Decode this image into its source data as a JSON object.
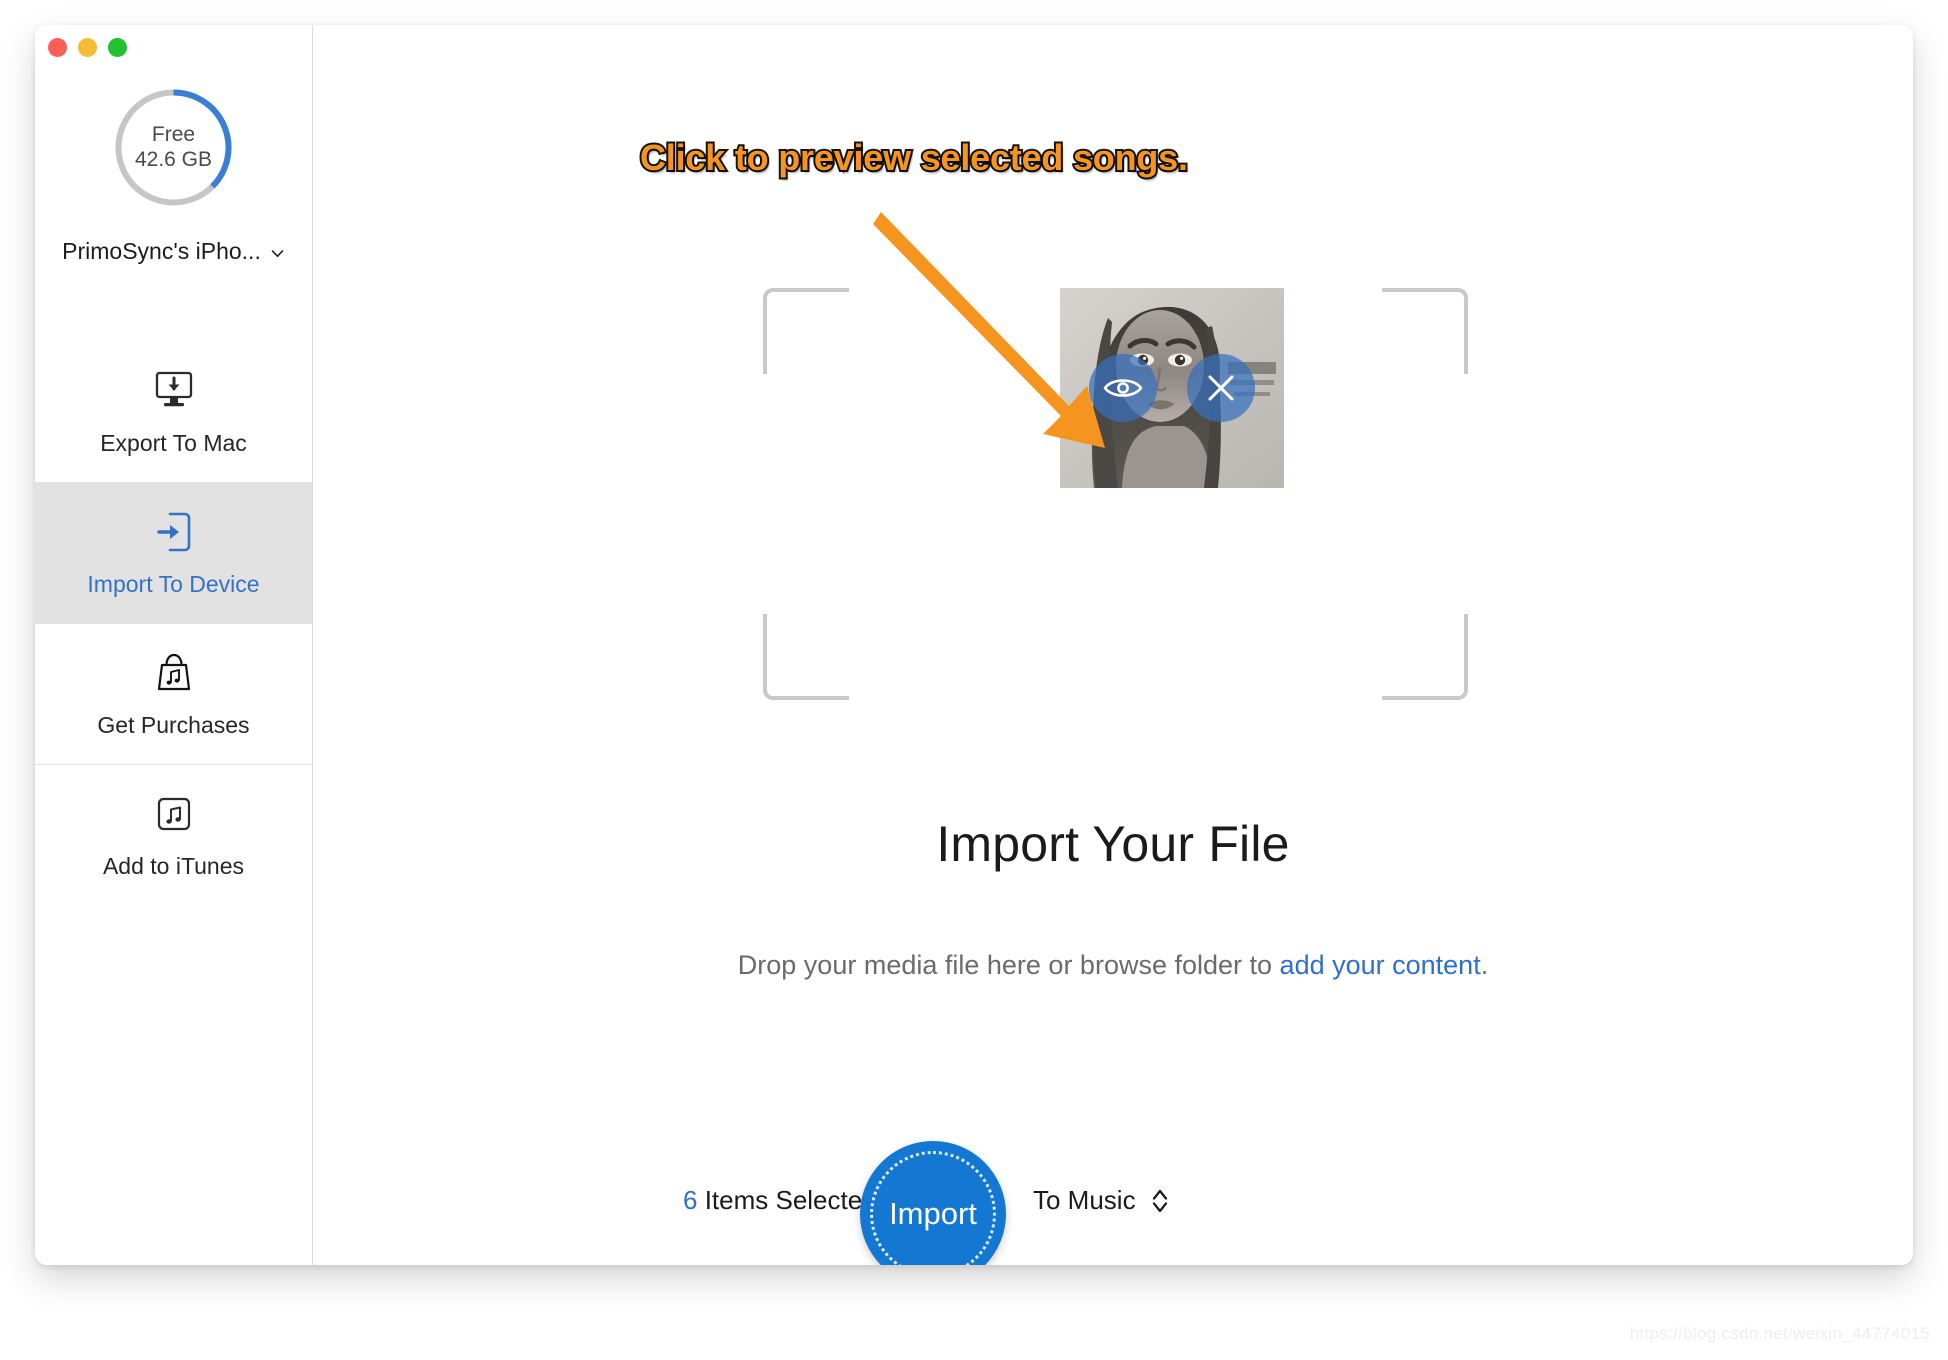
{
  "window": {
    "traffic_lights": {
      "close": "close-button",
      "minimize": "minimize-button",
      "maximize": "maximize-button"
    }
  },
  "sidebar": {
    "storage": {
      "free_label": "Free",
      "free_value": "42.6 GB",
      "used_percent": 30,
      "arc_color": "#3a7fd5",
      "track_color": "#c6c6c6"
    },
    "device": {
      "name": "PrimoSync's iPho...",
      "chevron": "chevron-down-icon"
    },
    "items": [
      {
        "label": "Export To Mac",
        "icon": "monitor-download-icon",
        "selected": false
      },
      {
        "label": "Import To Device",
        "icon": "import-arrow-icon",
        "selected": true
      },
      {
        "label": "Get Purchases",
        "icon": "shopping-bag-music-icon",
        "selected": false
      },
      {
        "label": "Add to iTunes",
        "icon": "music-note-square-icon",
        "selected": false
      }
    ]
  },
  "annotation": {
    "text": "Click to preview selected songs.",
    "text_color": "#f5941f",
    "outline_color": "#141414",
    "arrow_color": "#f5941f"
  },
  "main": {
    "dropzone": {
      "bracket_color": "#c9c9c9"
    },
    "thumbnail": {
      "alt": "album-artwork",
      "preview_button": "eye-icon",
      "remove_button": "close-x-icon",
      "button_color": "#3870bd"
    },
    "title": "Import Your File",
    "subtitle_prefix": "Drop your media file here or browse folder to ",
    "subtitle_link": "add your content",
    "subtitle_suffix": "."
  },
  "bottom_bar": {
    "selected_count": "6",
    "selected_label": " Items Selected",
    "import_label": "Import",
    "destination_label": "To Music",
    "destination_chevron": "chevron-up-down-icon",
    "import_color": "#1478d2"
  },
  "watermark": "https://blog.csdn.net/weixin_44774015"
}
